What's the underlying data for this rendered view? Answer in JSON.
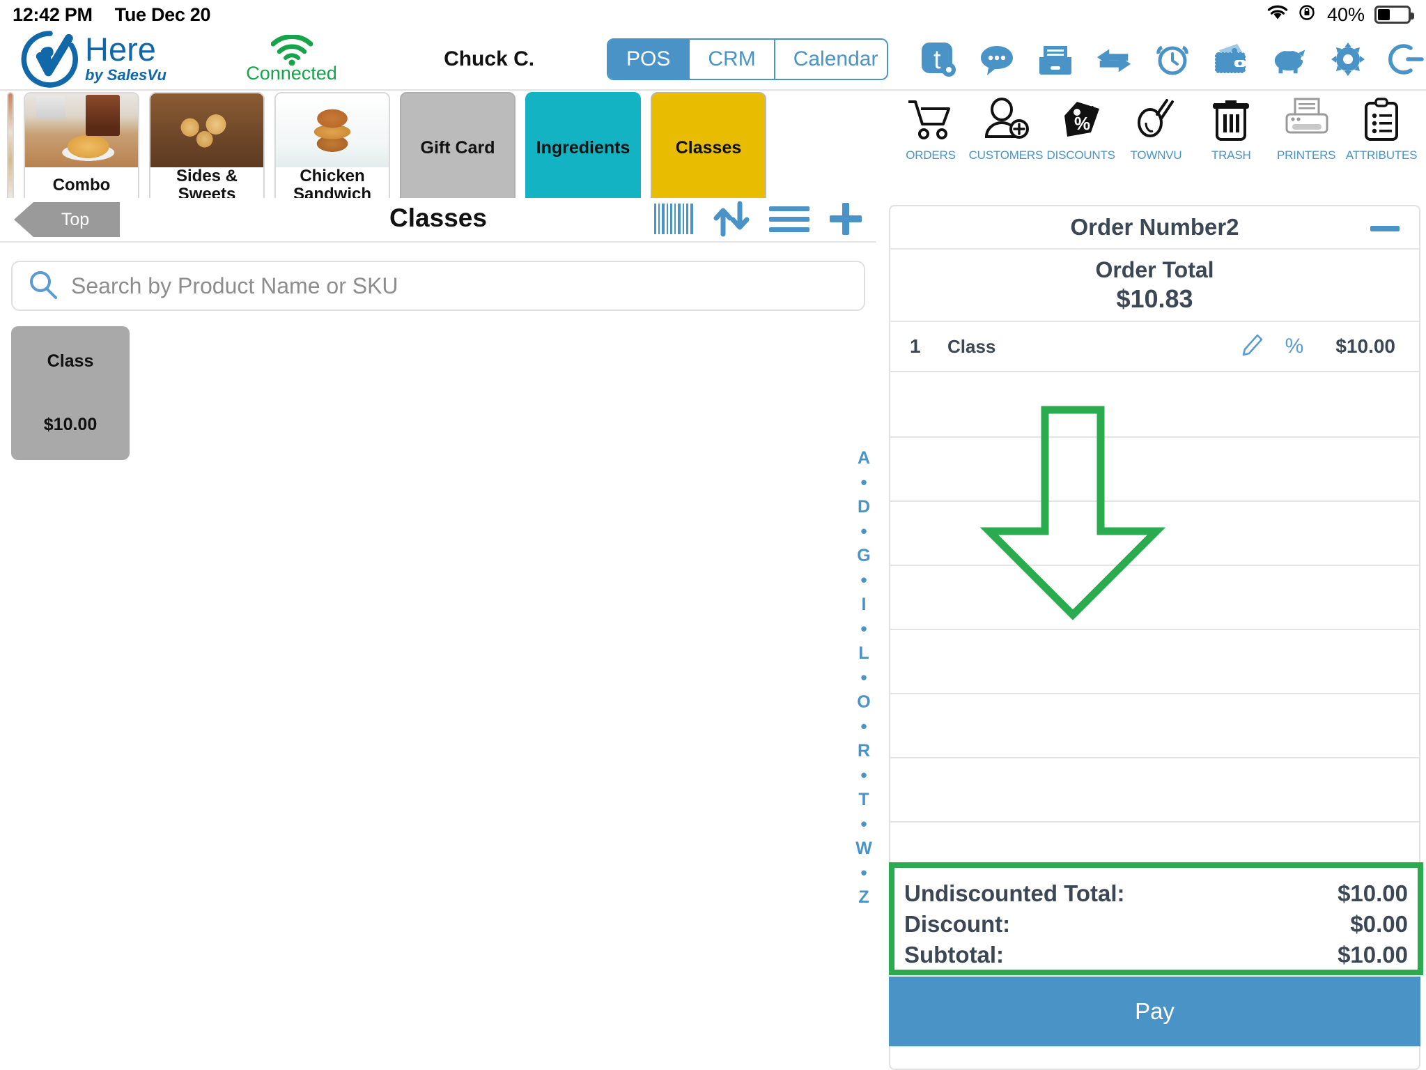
{
  "status_bar": {
    "time": "12:42 PM",
    "date": "Tue Dec 20",
    "battery_percent": "40%",
    "wifi_icon": "wifi-icon",
    "rotation_lock_icon": "rotation-lock-icon",
    "battery_icon": "battery-icon"
  },
  "header": {
    "logo_primary": "Here",
    "logo_secondary": "by SalesVu",
    "connection_status": "Connected",
    "user_name": "Chuck C.",
    "tabs": [
      {
        "label": "POS",
        "active": true
      },
      {
        "label": "CRM",
        "active": false
      },
      {
        "label": "Calendar",
        "active": false
      }
    ],
    "icons": [
      "tickets-settings-icon",
      "chat-bubble-icon",
      "file-drawer-icon",
      "transfer-arrows-icon",
      "alarm-clock-icon",
      "wallet-cash-icon",
      "piggy-bank-icon",
      "gear-icon",
      "logout-icon"
    ]
  },
  "categories": [
    {
      "label": "Combo",
      "style": "photo",
      "image": "combo-photo"
    },
    {
      "label": "Sides & Sweets",
      "style": "photo",
      "image": "sides-sweets-photo"
    },
    {
      "label": "Chicken Sandwich",
      "style": "photo",
      "image": "chicken-sandwich-photo"
    },
    {
      "label": "Gift Card",
      "style": "grey"
    },
    {
      "label": "Ingredients",
      "style": "teal"
    },
    {
      "label": "Classes",
      "style": "yellow"
    }
  ],
  "left_pane": {
    "back_button": "Top",
    "page_title": "Classes",
    "title_icons": [
      "barcode-icon",
      "sort-arrows-icon",
      "list-menu-icon",
      "plus-icon"
    ],
    "search": {
      "placeholder": "Search by Product Name or SKU",
      "value": "",
      "icon": "search-icon"
    },
    "products": [
      {
        "name": "Class",
        "price": "$10.00"
      }
    ],
    "alphabet_index": [
      "A",
      "•",
      "D",
      "•",
      "G",
      "•",
      "I",
      "•",
      "L",
      "•",
      "O",
      "•",
      "R",
      "•",
      "T",
      "•",
      "W",
      "•",
      "Z"
    ]
  },
  "right_pane": {
    "tools": [
      {
        "label": "ORDERS",
        "icon": "shopping-cart-icon"
      },
      {
        "label": "CUSTOMERS",
        "icon": "add-customer-icon"
      },
      {
        "label": "DISCOUNTS",
        "icon": "discount-tag-icon"
      },
      {
        "label": "TOWNVU",
        "icon": "townvu-icon"
      },
      {
        "label": "TRASH",
        "icon": "trash-icon"
      },
      {
        "label": "PRINTERS",
        "icon": "printer-icon"
      },
      {
        "label": "ATTRIBUTES",
        "icon": "clipboard-list-icon"
      }
    ],
    "order": {
      "title": "Order Number2",
      "collapse_icon": "minimize-icon",
      "total_label": "Order Total",
      "total_value": "$10.83",
      "line_items": [
        {
          "qty": "1",
          "name": "Class",
          "edit_icon": "pencil-icon",
          "percent_icon": "percent-icon",
          "price": "$10.00"
        }
      ],
      "totals": [
        {
          "label": "Undiscounted Total:",
          "value": "$10.00"
        },
        {
          "label": "Discount:",
          "value": "$0.00"
        },
        {
          "label": "Subtotal:",
          "value": "$10.00"
        }
      ],
      "pay_button": "Pay"
    }
  },
  "annotations": {
    "arrow_color": "#2aab4f",
    "highlight_color": "#2aab4f"
  },
  "colors": {
    "accent_blue": "#4a93c7",
    "connected_green": "#16a34a",
    "teal_tile": "#14b3c4",
    "yellow_tile": "#e8bc00",
    "grey_tile": "#bbbbbb",
    "product_tile": "#a9a9a9",
    "text_dark": "#3b4754"
  }
}
